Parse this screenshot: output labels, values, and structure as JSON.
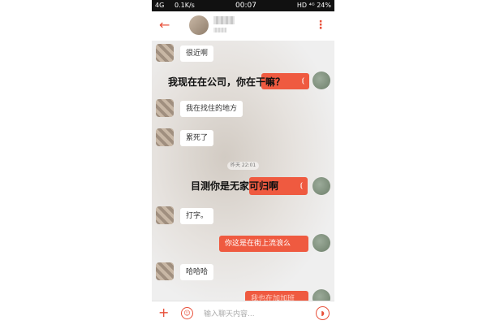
{
  "status_bar": {
    "network": "4G",
    "speed": "0.1K/s",
    "time": "00:07",
    "right": "HD ⁴ᴳ 24%"
  },
  "header": {
    "back_icon": "back-arrow-icon",
    "more_icon": "more-vert-icon"
  },
  "chat": {
    "timestamp": "昨天 22:01",
    "messages": [
      {
        "side": "left",
        "text": "很近啊"
      },
      {
        "side": "right",
        "text": "",
        "overlay": "我现在在公司，你在干嘛？"
      },
      {
        "side": "left",
        "text": "我在找住的地方"
      },
      {
        "side": "left",
        "text": "累死了"
      },
      {
        "side": "right",
        "text": "",
        "overlay": "目测你是无家可归啊"
      },
      {
        "side": "left",
        "text": "打字。"
      },
      {
        "side": "right",
        "text": "你这是在街上流浪么"
      },
      {
        "side": "left",
        "text": "哈哈哈"
      },
      {
        "side": "right",
        "text": "我也在加加班"
      }
    ]
  },
  "input_bar": {
    "placeholder": "输入聊天内容...",
    "plus_icon": "plus-icon",
    "emoji_icon": "emoji-icon",
    "voice_icon": "voice-icon"
  },
  "colors": {
    "accent": "#ef5a40",
    "status_bar_bg": "#111111",
    "bubble_left": "#ffffff"
  }
}
